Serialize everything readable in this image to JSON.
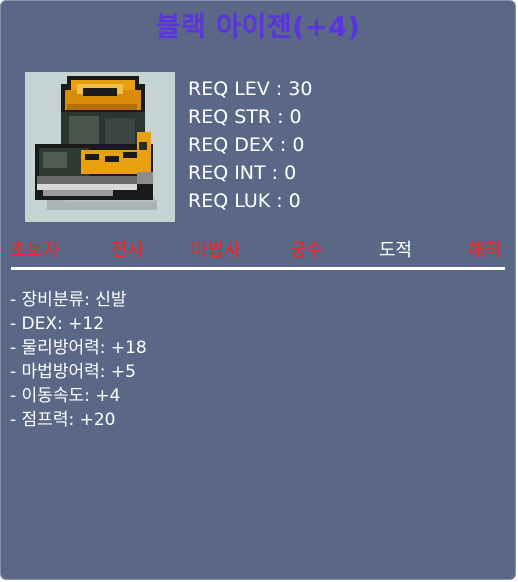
{
  "item": {
    "name": "블랙 아이젠(+4)",
    "icon": "black-boots-icon"
  },
  "requirements": [
    "REQ LEV : 30",
    "REQ STR : 0",
    "REQ DEX : 0",
    "REQ INT : 0",
    "REQ LUK : 0"
  ],
  "jobs": [
    {
      "label": "초보자",
      "allowed": false
    },
    {
      "label": "전사",
      "allowed": false
    },
    {
      "label": "마법사",
      "allowed": false
    },
    {
      "label": "궁수",
      "allowed": false
    },
    {
      "label": "도적",
      "allowed": true
    },
    {
      "label": "해적",
      "allowed": false
    }
  ],
  "stats": [
    "- 장비분류: 신발",
    "- DEX: +12",
    "- 물리방어력: +18",
    "- 마법방어력: +5",
    "- 이동속도: +4",
    "- 점프력: +20"
  ],
  "colors": {
    "panel": "#5a6786",
    "title": "#5b33e0",
    "job_disallowed": "#ff1d1d",
    "job_allowed": "#ffffff"
  }
}
